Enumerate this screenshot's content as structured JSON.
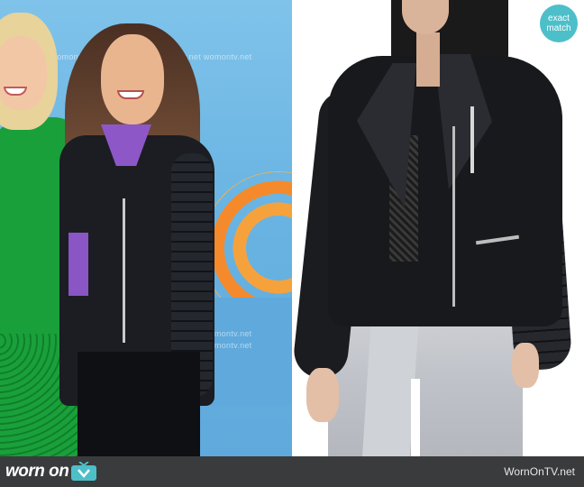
{
  "left_photo": {
    "watermark_text": "womontv.net  womontv.net  womontv.net  womontv.net  womontv.net"
  },
  "right_photo": {
    "badge": {
      "line1": "exact",
      "line2": "match",
      "color": "#4dbfc9"
    }
  },
  "footer": {
    "logo_text": "worn on",
    "logo_icon": "tv-icon",
    "site": "WornOnTV.net",
    "background": "#3a3b3d"
  }
}
